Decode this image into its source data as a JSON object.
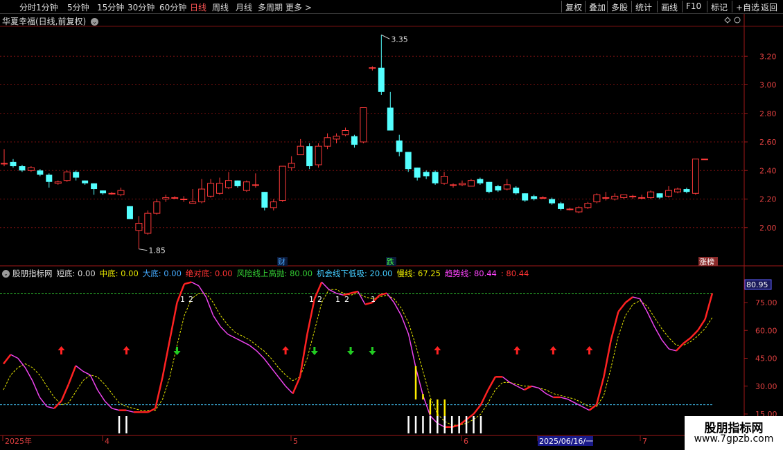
{
  "periods": [
    "分时",
    "1分钟",
    "5分钟",
    "15分钟",
    "30分钟",
    "60分钟",
    "日线",
    "周线",
    "月线",
    "多周期",
    "更多 >"
  ],
  "active_period": "日线",
  "right_tools": [
    "复权",
    "叠加",
    "多股",
    "统计",
    "画线",
    "F10",
    "标记",
    "+自选",
    "返回"
  ],
  "stock_title": "华夏幸福(日线,前复权)",
  "price_axis": [
    "3.20",
    "3.00",
    "2.80",
    "2.60",
    "2.40",
    "2.20",
    "2.00"
  ],
  "high_mark": "3.35",
  "low_mark": "1.85",
  "event_tags": [
    {
      "text": "财",
      "color": "#4aa8ff"
    },
    {
      "text": "跌",
      "color": "#44ff44"
    },
    {
      "text": "涨榜",
      "color": "#ffffff"
    }
  ],
  "indicator": {
    "name": "股朋指标网",
    "items": [
      {
        "text": "短底: 0.00",
        "color": "#dddddd"
      },
      {
        "text": "中底: 0.00",
        "color": "#e6e600"
      },
      {
        "text": "大底: 0.00",
        "color": "#44aaff"
      },
      {
        "text": "绝对底: 0.00",
        "color": "#ff3333"
      },
      {
        "text": "风险线上高抛: 80.00",
        "color": "#33cc33"
      },
      {
        "text": "机会线下低吸: 20.00",
        "color": "#44ccff"
      },
      {
        "text": "慢线: 67.25",
        "color": "#e6e600"
      },
      {
        "text": "趋势线: 80.44",
        "color": "#ff44ff"
      },
      {
        "text": ": 80.44",
        "color": "#ff3333"
      }
    ]
  },
  "indicator_axis": [
    "75.00",
    "60.00",
    "45.00",
    "30.00",
    "15.00"
  ],
  "indicator_current": "80.95",
  "date_axis": [
    "2025年",
    "4",
    "5",
    "6",
    "2025/06/16/一",
    "7"
  ],
  "markers_12": [
    "1",
    "2",
    "1",
    "2",
    "1",
    "2",
    "1"
  ],
  "watermark": {
    "line1": "股朋指标网",
    "line2": "www.7gpzb.com"
  },
  "colors": {
    "up": "#ff3a3a",
    "down": "#54ffff",
    "grid": "#7a1010",
    "risk": "#33cc33",
    "chance": "#44ccff"
  },
  "chart_data": {
    "type": "candlestick",
    "ylim": [
      1.8,
      3.4
    ],
    "candles": [
      [
        2.45,
        2.45,
        2.55,
        2.43
      ],
      [
        2.46,
        2.43,
        2.48,
        2.42
      ],
      [
        2.43,
        2.4,
        2.44,
        2.39
      ],
      [
        2.4,
        2.42,
        2.43,
        2.39
      ],
      [
        2.4,
        2.37,
        2.41,
        2.36
      ],
      [
        2.37,
        2.32,
        2.38,
        2.28
      ],
      [
        2.31,
        2.32,
        2.33,
        2.3
      ],
      [
        2.33,
        2.39,
        2.4,
        2.32
      ],
      [
        2.39,
        2.35,
        2.4,
        2.33
      ],
      [
        2.33,
        2.31,
        2.33,
        2.3
      ],
      [
        2.31,
        2.27,
        2.31,
        2.23
      ],
      [
        2.26,
        2.24,
        2.26,
        2.23
      ],
      [
        2.24,
        2.24,
        2.25,
        2.23
      ],
      [
        2.23,
        2.26,
        2.28,
        2.22
      ],
      [
        2.15,
        2.06,
        2.15,
        2.06
      ],
      [
        1.98,
        2.03,
        2.08,
        1.85
      ],
      [
        1.96,
        2.1,
        2.12,
        1.95
      ],
      [
        2.1,
        2.18,
        2.2,
        2.09
      ],
      [
        2.2,
        2.21,
        2.23,
        2.18
      ],
      [
        2.21,
        2.21,
        2.22,
        2.2
      ],
      [
        2.2,
        2.2,
        2.22,
        2.18
      ],
      [
        2.17,
        2.18,
        2.27,
        2.17
      ],
      [
        2.18,
        2.27,
        2.34,
        2.17
      ],
      [
        2.22,
        2.31,
        2.34,
        2.21
      ],
      [
        2.24,
        2.31,
        2.35,
        2.23
      ],
      [
        2.28,
        2.33,
        2.39,
        2.27
      ],
      [
        2.33,
        2.29,
        2.33,
        2.28
      ],
      [
        2.26,
        2.32,
        2.33,
        2.25
      ],
      [
        2.3,
        2.3,
        2.38,
        2.28
      ],
      [
        2.25,
        2.14,
        2.25,
        2.12
      ],
      [
        2.14,
        2.18,
        2.2,
        2.12
      ],
      [
        2.19,
        2.43,
        2.43,
        2.18
      ],
      [
        2.42,
        2.45,
        2.5,
        2.4
      ],
      [
        2.51,
        2.57,
        2.62,
        2.51
      ],
      [
        2.57,
        2.43,
        2.59,
        2.41
      ],
      [
        2.44,
        2.57,
        2.59,
        2.42
      ],
      [
        2.57,
        2.63,
        2.66,
        2.55
      ],
      [
        2.62,
        2.64,
        2.66,
        2.59
      ],
      [
        2.65,
        2.68,
        2.7,
        2.64
      ],
      [
        2.64,
        2.58,
        2.65,
        2.56
      ],
      [
        2.6,
        2.84,
        2.84,
        2.59
      ],
      [
        3.12,
        3.12,
        3.13,
        3.1
      ],
      [
        3.12,
        2.95,
        3.35,
        2.93
      ],
      [
        2.84,
        2.68,
        2.95,
        2.68
      ],
      [
        2.61,
        2.53,
        2.65,
        2.5
      ],
      [
        2.53,
        2.41,
        2.53,
        2.39
      ],
      [
        2.42,
        2.35,
        2.42,
        2.33
      ],
      [
        2.39,
        2.36,
        2.4,
        2.34
      ],
      [
        2.39,
        2.31,
        2.4,
        2.3
      ],
      [
        2.31,
        2.36,
        2.39,
        2.3
      ],
      [
        2.3,
        2.3,
        2.31,
        2.28
      ],
      [
        2.3,
        2.31,
        2.33,
        2.29
      ],
      [
        2.29,
        2.33,
        2.34,
        2.29
      ],
      [
        2.34,
        2.31,
        2.35,
        2.3
      ],
      [
        2.32,
        2.25,
        2.32,
        2.24
      ],
      [
        2.29,
        2.26,
        2.3,
        2.25
      ],
      [
        2.27,
        2.3,
        2.34,
        2.26
      ],
      [
        2.28,
        2.24,
        2.29,
        2.23
      ],
      [
        2.24,
        2.19,
        2.24,
        2.18
      ],
      [
        2.22,
        2.2,
        2.23,
        2.19
      ],
      [
        2.21,
        2.21,
        2.22,
        2.2
      ],
      [
        2.2,
        2.17,
        2.21,
        2.16
      ],
      [
        2.17,
        2.13,
        2.18,
        2.12
      ],
      [
        2.13,
        2.13,
        2.14,
        2.12
      ],
      [
        2.11,
        2.14,
        2.15,
        2.1
      ],
      [
        2.14,
        2.17,
        2.18,
        2.13
      ],
      [
        2.18,
        2.23,
        2.24,
        2.17
      ],
      [
        2.21,
        2.21,
        2.25,
        2.19
      ],
      [
        2.2,
        2.22,
        2.24,
        2.19
      ],
      [
        2.21,
        2.23,
        2.23,
        2.2
      ],
      [
        2.22,
        2.22,
        2.23,
        2.2
      ],
      [
        2.21,
        2.21,
        2.23,
        2.2
      ],
      [
        2.21,
        2.25,
        2.26,
        2.2
      ],
      [
        2.24,
        2.21,
        2.24,
        2.2
      ],
      [
        2.22,
        2.26,
        2.29,
        2.21
      ],
      [
        2.25,
        2.27,
        2.28,
        2.24
      ],
      [
        2.27,
        2.25,
        2.28,
        2.24
      ],
      [
        2.24,
        2.48,
        2.48,
        2.23
      ],
      [
        2.48,
        2.48,
        2.48,
        2.48
      ]
    ],
    "indicator_ylim": [
      5,
      90
    ],
    "indicator_series": {
      "trend": [
        42,
        47,
        45,
        40,
        33,
        24,
        19,
        18,
        22,
        31,
        41,
        38,
        36,
        28,
        22,
        18,
        17,
        17,
        16,
        16,
        16,
        18,
        35,
        55,
        75,
        85,
        86,
        84,
        78,
        68,
        62,
        58,
        56,
        54,
        52,
        49,
        45,
        40,
        35,
        30,
        26,
        35,
        58,
        77,
        86,
        82,
        80,
        79,
        80,
        81,
        74,
        75,
        79,
        80,
        75,
        68,
        58,
        40,
        25,
        14,
        10,
        8,
        8,
        9,
        12,
        15,
        20,
        28,
        35,
        35,
        32,
        30,
        28,
        30,
        29,
        26,
        24,
        24,
        23,
        21,
        19,
        17,
        20,
        35,
        55,
        70,
        75,
        78,
        77,
        70,
        62,
        55,
        50,
        49,
        53,
        56,
        60,
        66,
        80
      ],
      "slow": [
        28,
        36,
        40,
        42,
        40,
        36,
        30,
        24,
        20,
        21,
        27,
        33,
        36,
        35,
        31,
        26,
        21,
        19,
        18,
        17,
        17,
        17,
        23,
        35,
        52,
        68,
        77,
        80,
        80,
        75,
        68,
        63,
        59,
        57,
        55,
        52,
        49,
        45,
        40,
        36,
        33,
        35,
        45,
        60,
        75,
        82,
        82,
        80,
        79,
        80,
        78,
        77,
        78,
        79,
        77,
        72,
        64,
        52,
        38,
        24,
        15,
        11,
        9,
        9,
        10,
        12,
        15,
        21,
        28,
        32,
        32,
        31,
        30,
        30,
        29,
        28,
        26,
        25,
        24,
        23,
        21,
        19,
        19,
        25,
        40,
        57,
        68,
        74,
        76,
        73,
        67,
        61,
        56,
        52,
        52,
        54,
        57,
        61,
        67
      ],
      "signals": [
        {
          "x": 8,
          "type": "up"
        },
        {
          "x": 17,
          "type": "up"
        },
        {
          "x": 24,
          "type": "down"
        },
        {
          "x": 39,
          "type": "up"
        },
        {
          "x": 43,
          "type": "down"
        },
        {
          "x": 48,
          "type": "down"
        },
        {
          "x": 51,
          "type": "down"
        },
        {
          "x": 60,
          "type": "up"
        },
        {
          "x": 71,
          "type": "up"
        },
        {
          "x": 76,
          "type": "up"
        },
        {
          "x": 81,
          "type": "up"
        }
      ],
      "yellow_bars": [
        57,
        58,
        59,
        60,
        61
      ],
      "white_bars": [
        16,
        17,
        56,
        57,
        58,
        59,
        60,
        61,
        62,
        63,
        64,
        65,
        66
      ]
    }
  }
}
